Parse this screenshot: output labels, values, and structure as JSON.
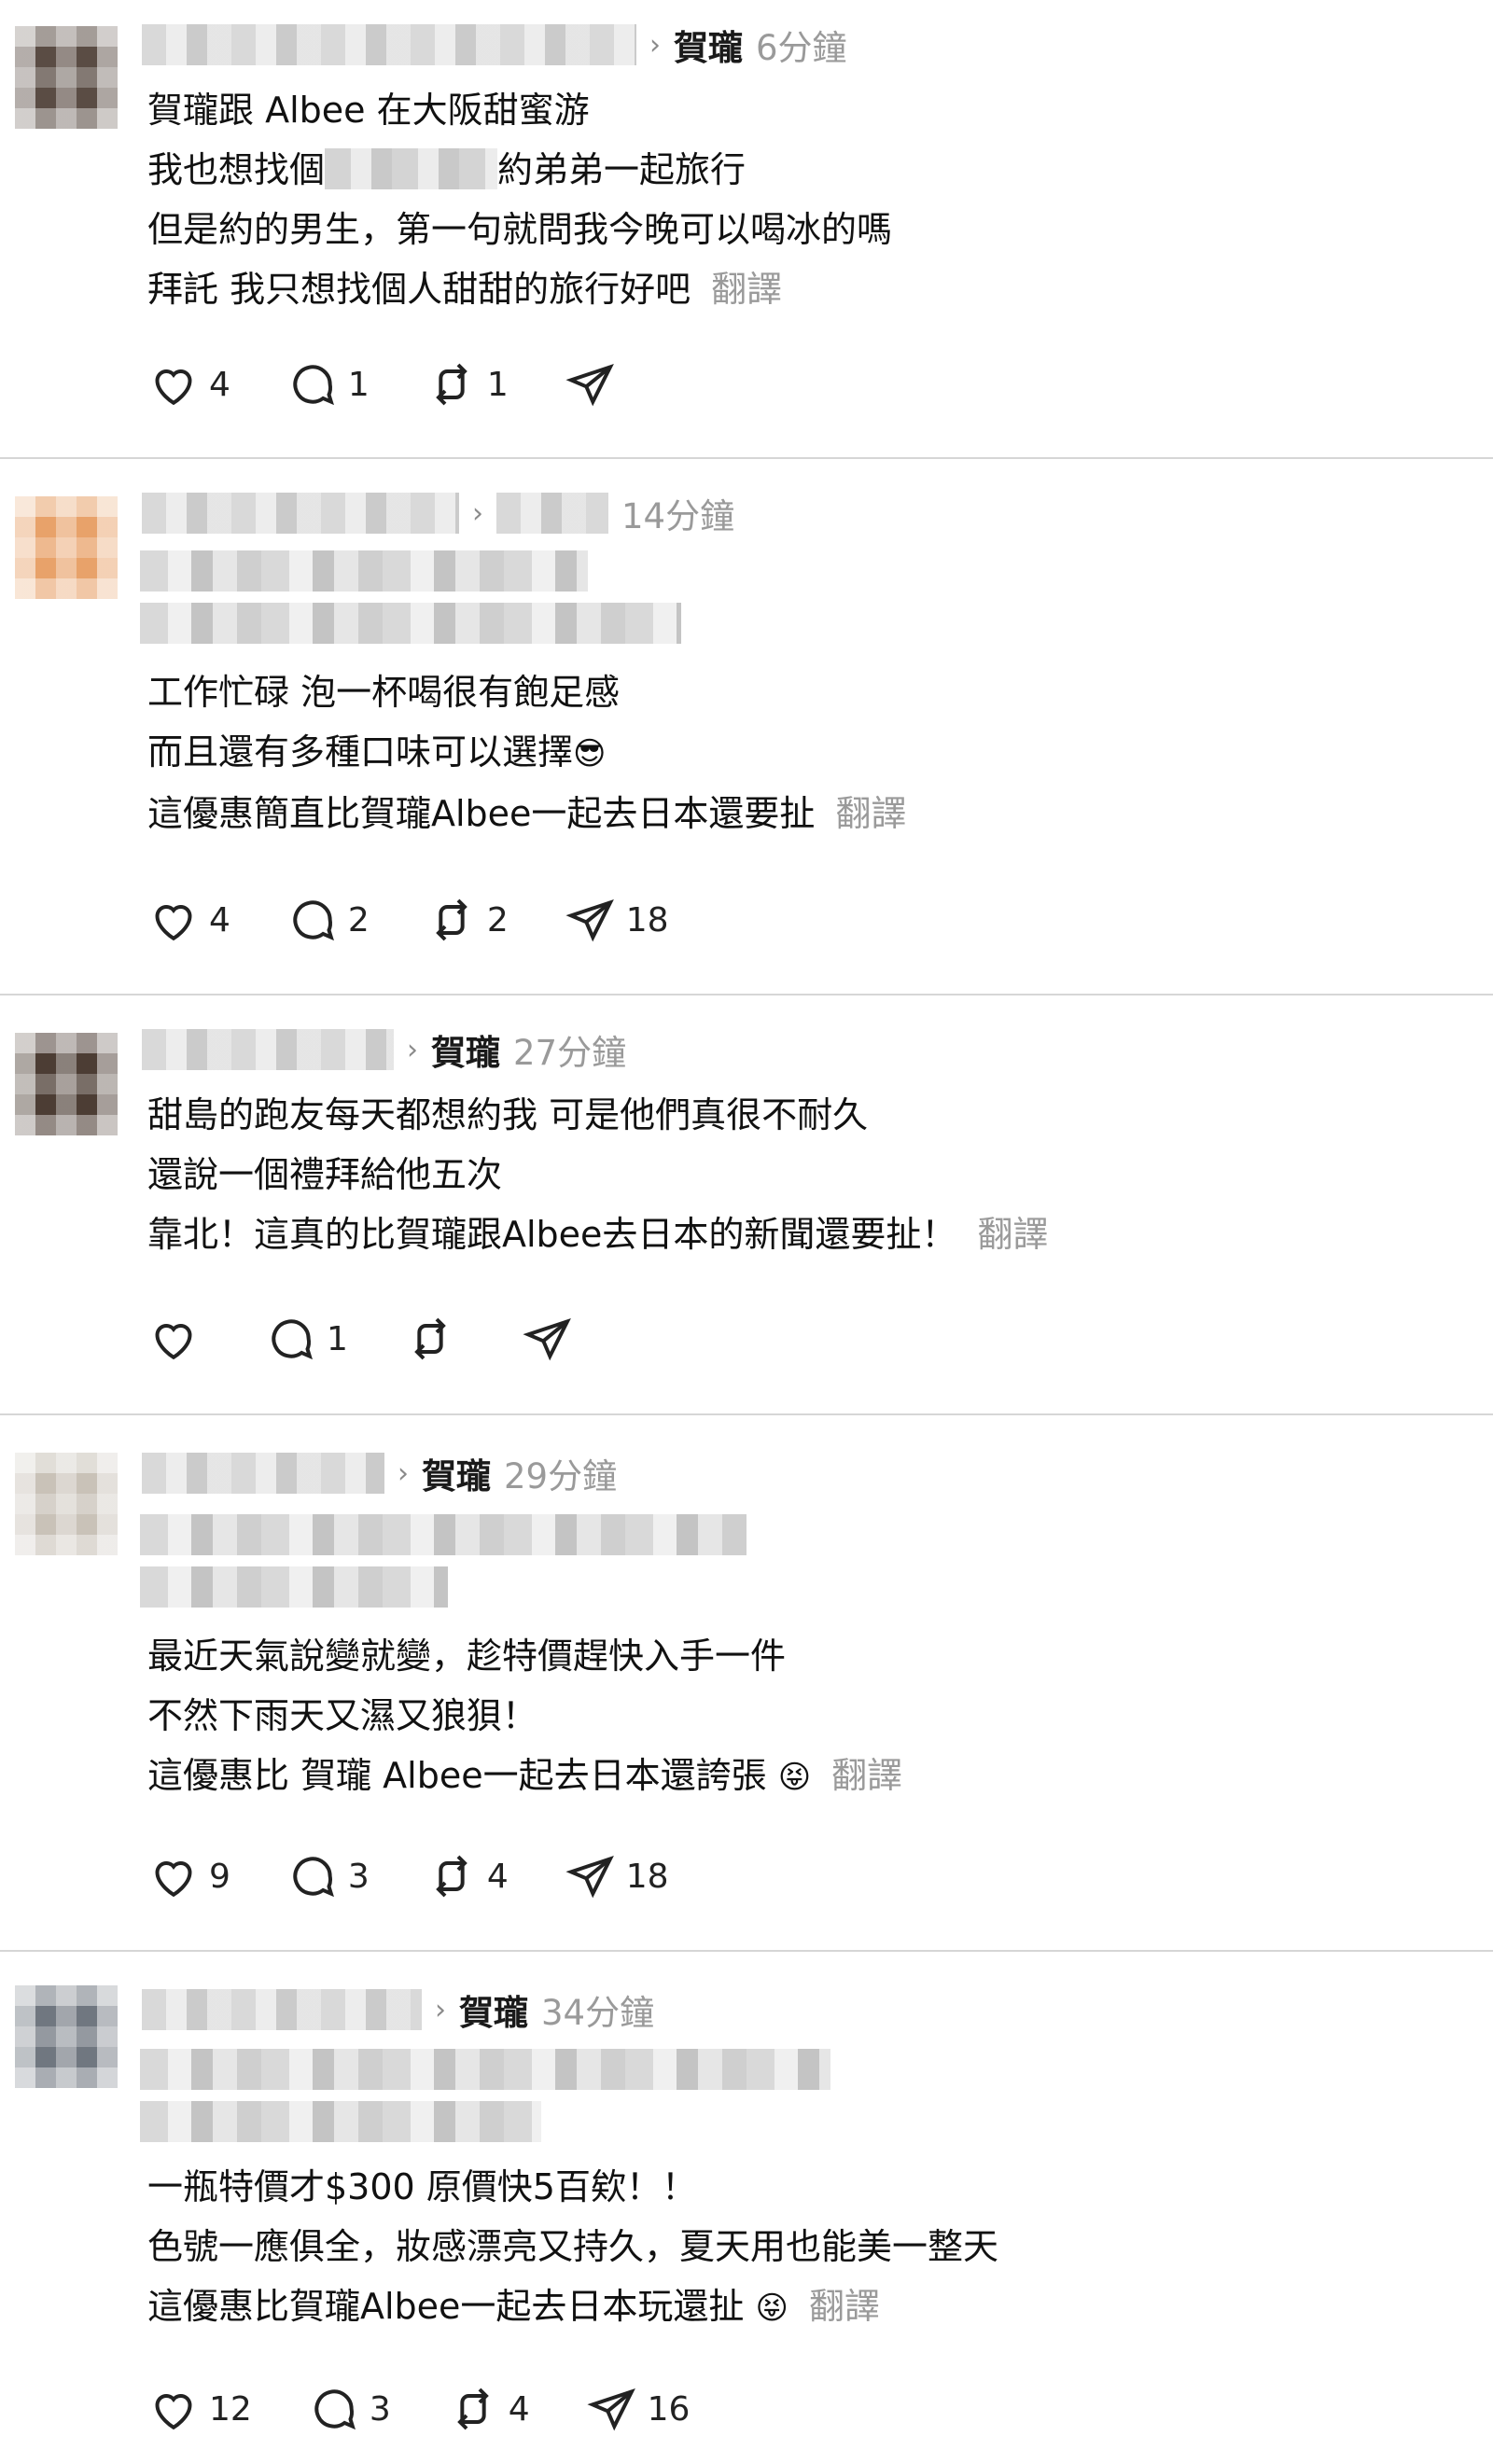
{
  "posts": [
    {
      "reply_to": "賀瓏",
      "time": "6分鐘",
      "lines": [
        "賀瓏跟 Albee 在大阪甜蜜游",
        "我也想找個",
        "約弟弟一起旅行",
        "但是約的男生，第一句就問我今晚可以喝冰的嗎",
        "拜託 我只想找個人甜甜的旅行好吧"
      ],
      "translate": "翻譯",
      "likes": "4",
      "replies": "1",
      "reposts": "1",
      "shares": ""
    },
    {
      "reply_to": "",
      "time": "14分鐘",
      "lines": [
        "工作忙碌 泡一杯喝很有飽足感",
        "而且還有多種口味可以選擇",
        "這優惠簡直比賀瓏Albee一起去日本還要扯"
      ],
      "emoji": "😎",
      "translate": "翻譯",
      "likes": "4",
      "replies": "2",
      "reposts": "2",
      "shares": "18"
    },
    {
      "reply_to": "賀瓏",
      "time": "27分鐘",
      "lines": [
        "甜島的跑友每天都想約我 可是他們真很不耐久",
        "還說一個禮拜給他五次",
        "靠北！這真的比賀瓏跟Albee去日本的新聞還要扯！"
      ],
      "translate": "翻譯",
      "likes": "",
      "replies": "1",
      "reposts": "",
      "shares": ""
    },
    {
      "reply_to": "賀瓏",
      "time": "29分鐘",
      "lines": [
        "最近天氣說變就變，趁特價趕快入手一件",
        "不然下雨天又濕又狼狽！",
        "這優惠比 賀瓏 Albee一起去日本還誇張"
      ],
      "emoji": "😝",
      "translate": "翻譯",
      "likes": "9",
      "replies": "3",
      "reposts": "4",
      "shares": "18"
    },
    {
      "reply_to": "賀瓏",
      "time": "34分鐘",
      "lines": [
        "一瓶特價才$300 原價快5百欸！！",
        "色號一應俱全，妝感漂亮又持久，夏天用也能美一整天",
        "這優惠比賀瓏Albee一起去日本玩還扯"
      ],
      "emoji": "😝",
      "translate": "翻譯",
      "likes": "12",
      "replies": "3",
      "reposts": "4",
      "shares": "16"
    }
  ],
  "icons": {
    "like": "heart-icon",
    "reply": "comment-bubble-icon",
    "repost": "repost-icon",
    "share": "send-icon",
    "chevron": "chevron-right-icon"
  },
  "colors": {
    "muted": "#9a9a9a",
    "divider": "#d6d6d6",
    "text": "#111111"
  }
}
